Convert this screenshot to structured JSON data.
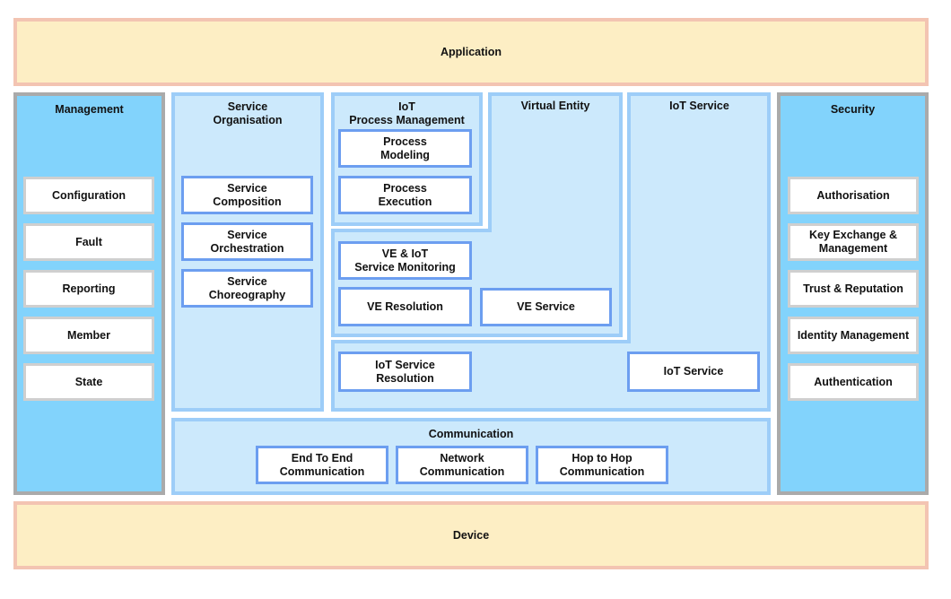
{
  "application": "Application",
  "device": "Device",
  "management": {
    "title": "Management",
    "items": [
      "Configuration",
      "Fault",
      "Reporting",
      "Member",
      "State"
    ]
  },
  "security": {
    "title": "Security",
    "items": [
      "Authorisation",
      "Key Exchange &\nManagement",
      "Trust & Reputation",
      "Identity Management",
      "Authentication"
    ]
  },
  "service_organisation": {
    "title": "Service\nOrganisation",
    "items": [
      "Service\nComposition",
      "Service\nOrchestration",
      "Service\nChoreography"
    ]
  },
  "iot_process_management": {
    "title": "IoT\nProcess Management",
    "items": [
      "Process\nModeling",
      "Process\nExecution"
    ]
  },
  "virtual_entity": {
    "title": "Virtual Entity",
    "items": [
      "VE & IoT\nService Monitoring",
      "VE Resolution",
      "VE Service"
    ]
  },
  "iot_service": {
    "title": "IoT Service",
    "items": [
      "IoT Service\nResolution",
      "IoT Service"
    ]
  },
  "communication": {
    "title": "Communication",
    "items": [
      "End To End\nCommunication",
      "Network\nCommunication",
      "Hop to Hop\nCommunication"
    ]
  },
  "colors": {
    "layer_fill": "#fdeec4",
    "layer_border": "#f3c4b2",
    "side_fill": "#82d3fc",
    "panel_fill": "#cce9fc",
    "panel_border": "#9dcdf8",
    "box_border": "#6c9ef0"
  }
}
